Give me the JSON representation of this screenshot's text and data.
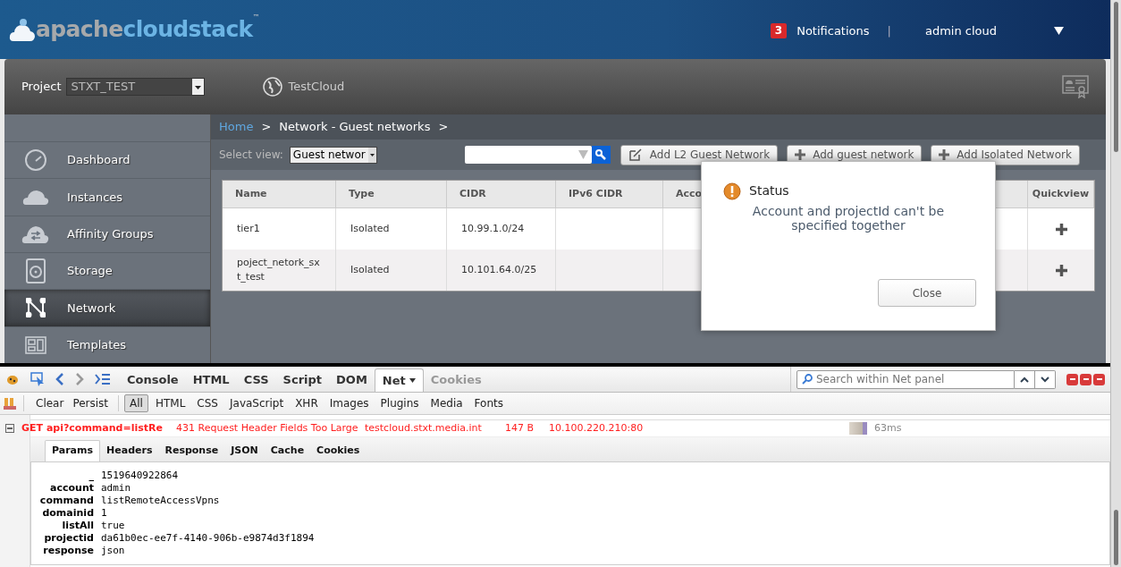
{
  "header": {
    "logo_text_1": "apache",
    "logo_text_2": "cloudstack",
    "logo_tm": "™",
    "notifications": {
      "count": "3",
      "label": "Notifications"
    },
    "separator": "|",
    "user": "admin cloud"
  },
  "project_bar": {
    "label": "Project",
    "project": "STXT_TEST",
    "zone": "TestCloud"
  },
  "sidebar": {
    "items": [
      {
        "label": "Dashboard",
        "kind": "gauge",
        "selected": false
      },
      {
        "label": "Instances",
        "kind": "cloud",
        "selected": false
      },
      {
        "label": "Affinity Groups",
        "kind": "cloud-arrows",
        "selected": false
      },
      {
        "label": "Storage",
        "kind": "disk",
        "selected": false
      },
      {
        "label": "Network",
        "kind": "network",
        "selected": true
      },
      {
        "label": "Templates",
        "kind": "template",
        "selected": false
      }
    ]
  },
  "breadcrumb": [
    {
      "label": "Home",
      "link": true
    },
    {
      "label": "Network - Guest networks",
      "link": false
    }
  ],
  "breadcrumb_separator": ">",
  "toolbar": {
    "select_view_label": "Select view:",
    "select_view": "Guest networ",
    "buttons": [
      {
        "label": "Add L2 Guest Network",
        "kind": "edit"
      },
      {
        "label": "Add guest network",
        "kind": "plus"
      },
      {
        "label": "Add Isolated Network",
        "kind": "plus"
      }
    ]
  },
  "table": {
    "columns": [
      "Name",
      "Type",
      "CIDR",
      "IPv6 CIDR",
      "Acco",
      "Quickview"
    ],
    "rows": [
      {
        "cells": [
          "tier1",
          "Isolated",
          "10.99.1.0/24",
          ""
        ]
      },
      {
        "cells": [
          "poject_netork_sxt_test",
          "Isolated",
          "10.101.64.0/25",
          ""
        ]
      }
    ]
  },
  "dialog": {
    "title": "Status",
    "message": "Account and projectId can't be specified together",
    "button": "Close"
  },
  "firebug": {
    "tabs": [
      {
        "label": "Console",
        "selected": false
      },
      {
        "label": "HTML",
        "selected": false
      },
      {
        "label": "CSS",
        "selected": false
      },
      {
        "label": "Script",
        "selected": false
      },
      {
        "label": "DOM",
        "selected": false
      },
      {
        "label": "Net",
        "selected": true
      },
      {
        "label": "Cookies",
        "selected": false,
        "disabled": true
      }
    ],
    "search_placeholder": "Search within Net panel",
    "filter_actions": [
      "Clear",
      "Persist"
    ],
    "filters": [
      {
        "label": "All",
        "selected": true
      },
      {
        "label": "HTML",
        "selected": false
      },
      {
        "label": "CSS",
        "selected": false
      },
      {
        "label": "JavaScript",
        "selected": false
      },
      {
        "label": "XHR",
        "selected": false
      },
      {
        "label": "Images",
        "selected": false
      },
      {
        "label": "Plugins",
        "selected": false
      },
      {
        "label": "Media",
        "selected": false
      },
      {
        "label": "Fonts",
        "selected": false
      }
    ],
    "request": {
      "url": "GET api?command=listRe",
      "status": "431 Request Header Fields Too Large",
      "domain": "testcloud.stxt.media.int",
      "size": "147 B",
      "remote": "10.100.220.210:80",
      "time": "63ms",
      "expanded": true
    },
    "detail_tabs": [
      {
        "label": "Params",
        "selected": true
      },
      {
        "label": "Headers",
        "selected": false
      },
      {
        "label": "Response",
        "selected": false
      },
      {
        "label": "JSON",
        "selected": false
      },
      {
        "label": "Cache",
        "selected": false
      },
      {
        "label": "Cookies",
        "selected": false
      }
    ],
    "params": [
      {
        "name": "_",
        "value": "1519640922864"
      },
      {
        "name": "account",
        "value": "admin"
      },
      {
        "name": "command",
        "value": "listRemoteAccessVpns"
      },
      {
        "name": "domainid",
        "value": "1"
      },
      {
        "name": "listAll",
        "value": "true"
      },
      {
        "name": "projectid",
        "value": "da61b0ec-ee7f-4140-906b-e9874d3f1894"
      },
      {
        "name": "response",
        "value": "json"
      }
    ]
  }
}
